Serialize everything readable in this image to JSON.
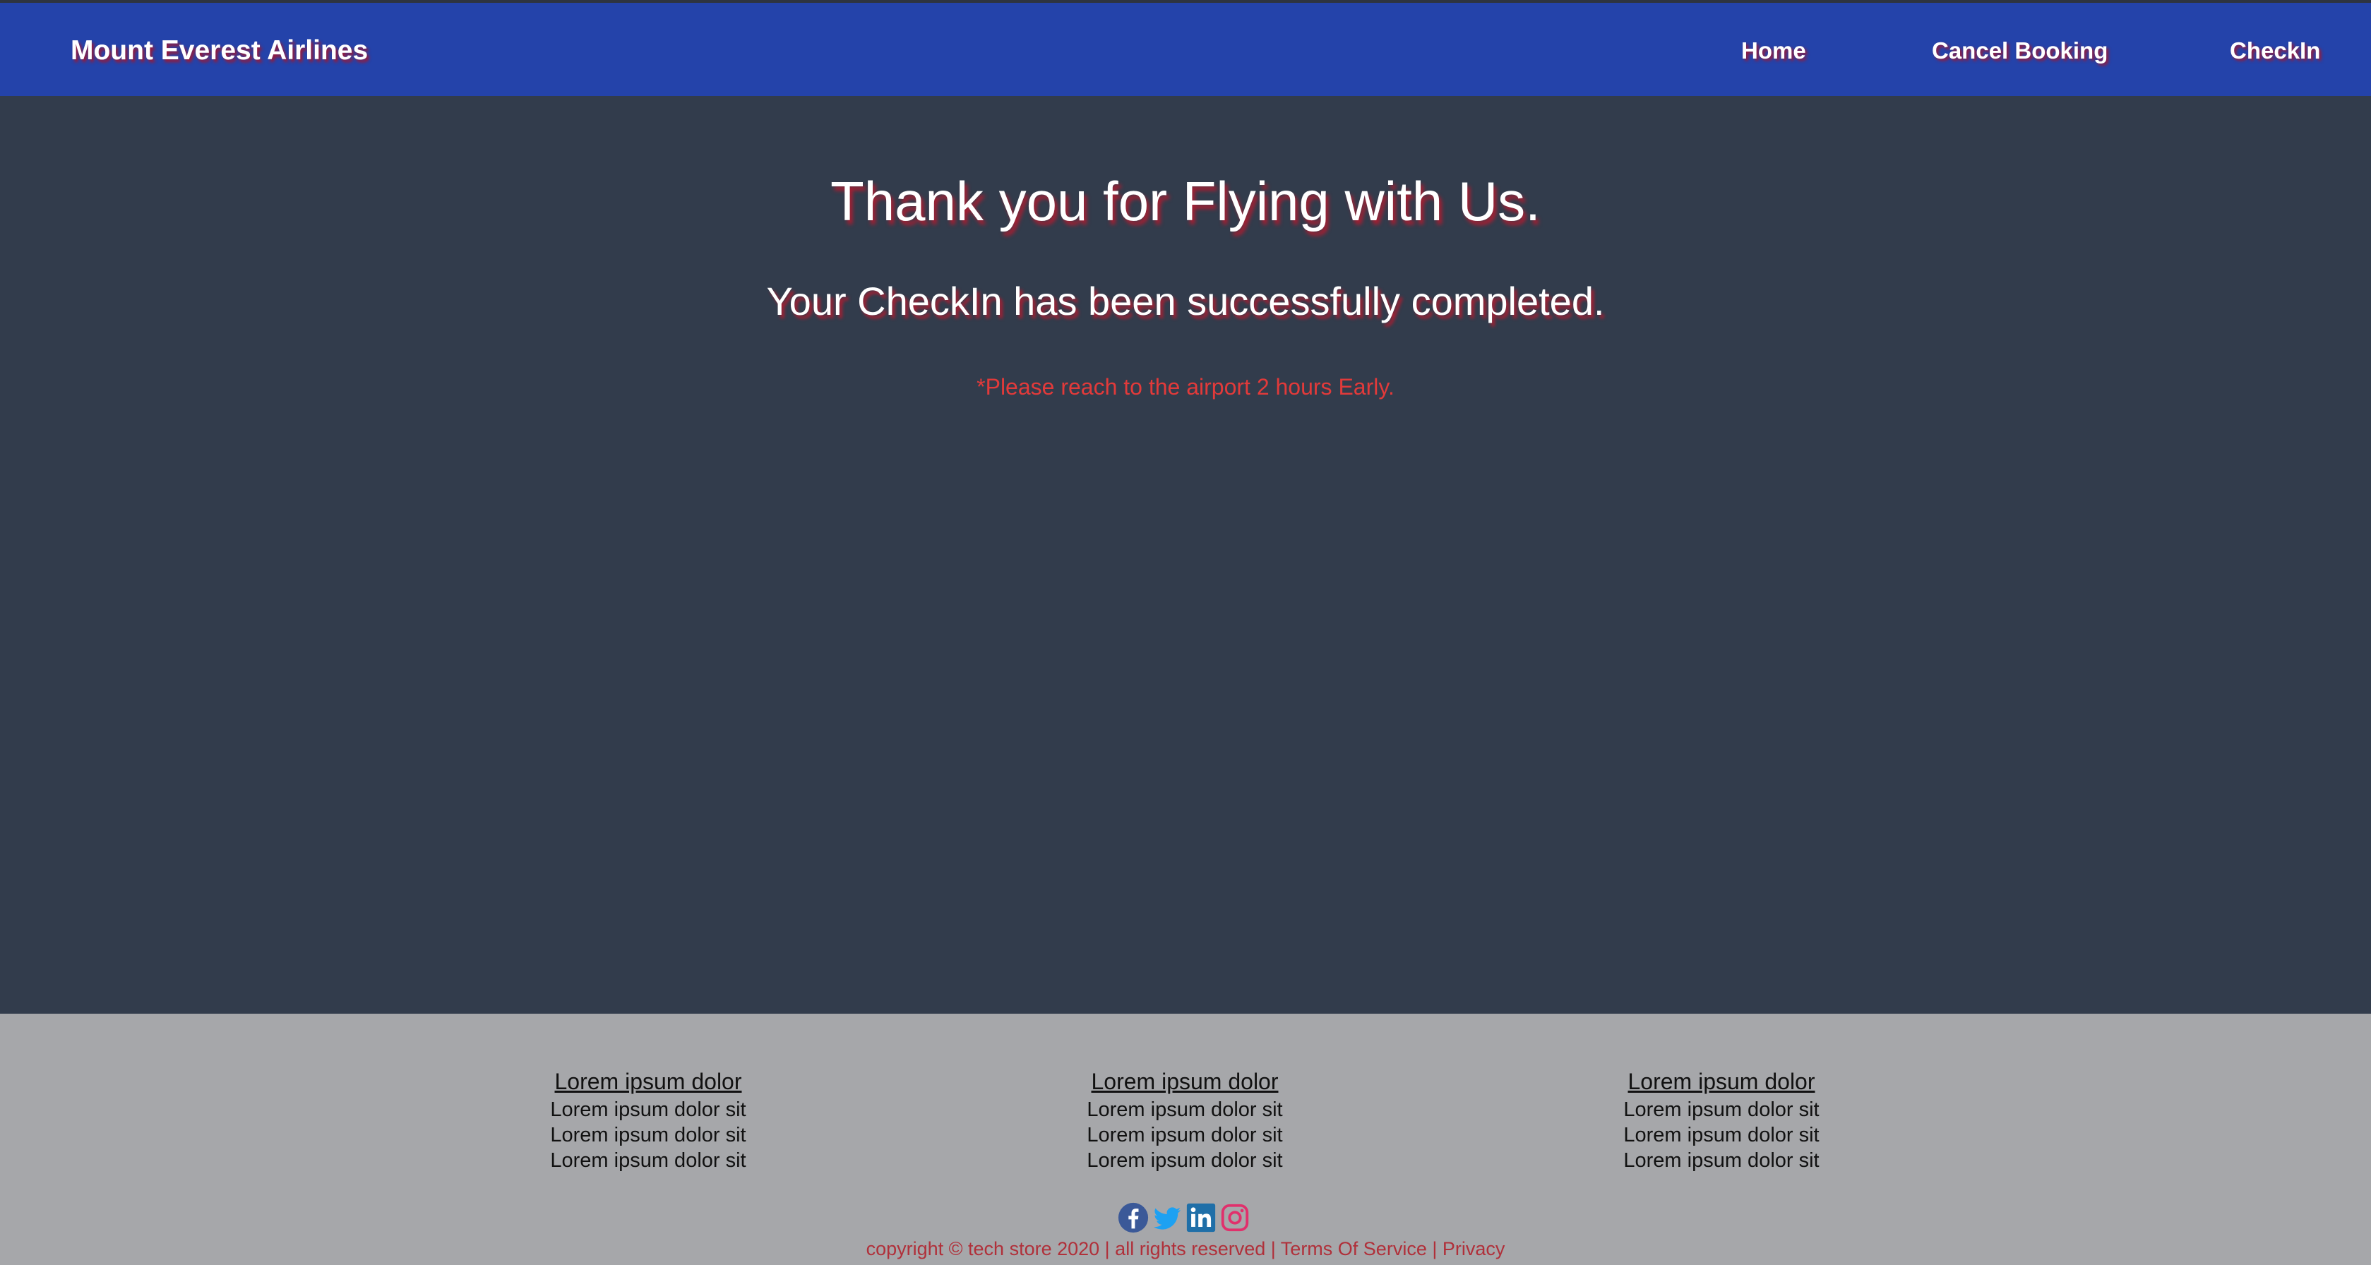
{
  "navbar": {
    "brand": "Mount Everest Airlines",
    "links": [
      "Home",
      "Cancel Booking",
      "CheckIn"
    ]
  },
  "main": {
    "heading": "Thank you for Flying with Us.",
    "subheading": "Your CheckIn has been successfully completed.",
    "note": "*Please reach to the airport 2 hours Early."
  },
  "footer": {
    "columns": [
      {
        "title": "Lorem ipsum dolor",
        "items": [
          "Lorem ipsum dolor sit",
          "Lorem ipsum dolor sit",
          "Lorem ipsum dolor sit"
        ]
      },
      {
        "title": "Lorem ipsum dolor",
        "items": [
          "Lorem ipsum dolor sit",
          "Lorem ipsum dolor sit",
          "Lorem ipsum dolor sit"
        ]
      },
      {
        "title": "Lorem ipsum dolor",
        "items": [
          "Lorem ipsum dolor sit",
          "Lorem ipsum dolor sit",
          "Lorem ipsum dolor sit"
        ]
      }
    ],
    "social": {
      "icons": [
        "facebook-icon",
        "twitter-icon",
        "linkedin-icon",
        "instagram-icon"
      ],
      "colors": {
        "facebook": "#3b5998",
        "twitter": "#1da1f2",
        "linkedin": "#1f6fa8",
        "instagram": "#e1306c"
      }
    },
    "copyright": {
      "text": "copyright © tech store 2020 | all rights reserved |",
      "terms": "Terms Of Service",
      "separator": "|",
      "privacy": "Privacy"
    }
  },
  "colors": {
    "navbar_bg": "#2443aa",
    "main_bg": "#323c4c",
    "footer_bg": "#a6a7aa",
    "note_text": "#e23a3a",
    "copyright_text": "#b0303a"
  }
}
